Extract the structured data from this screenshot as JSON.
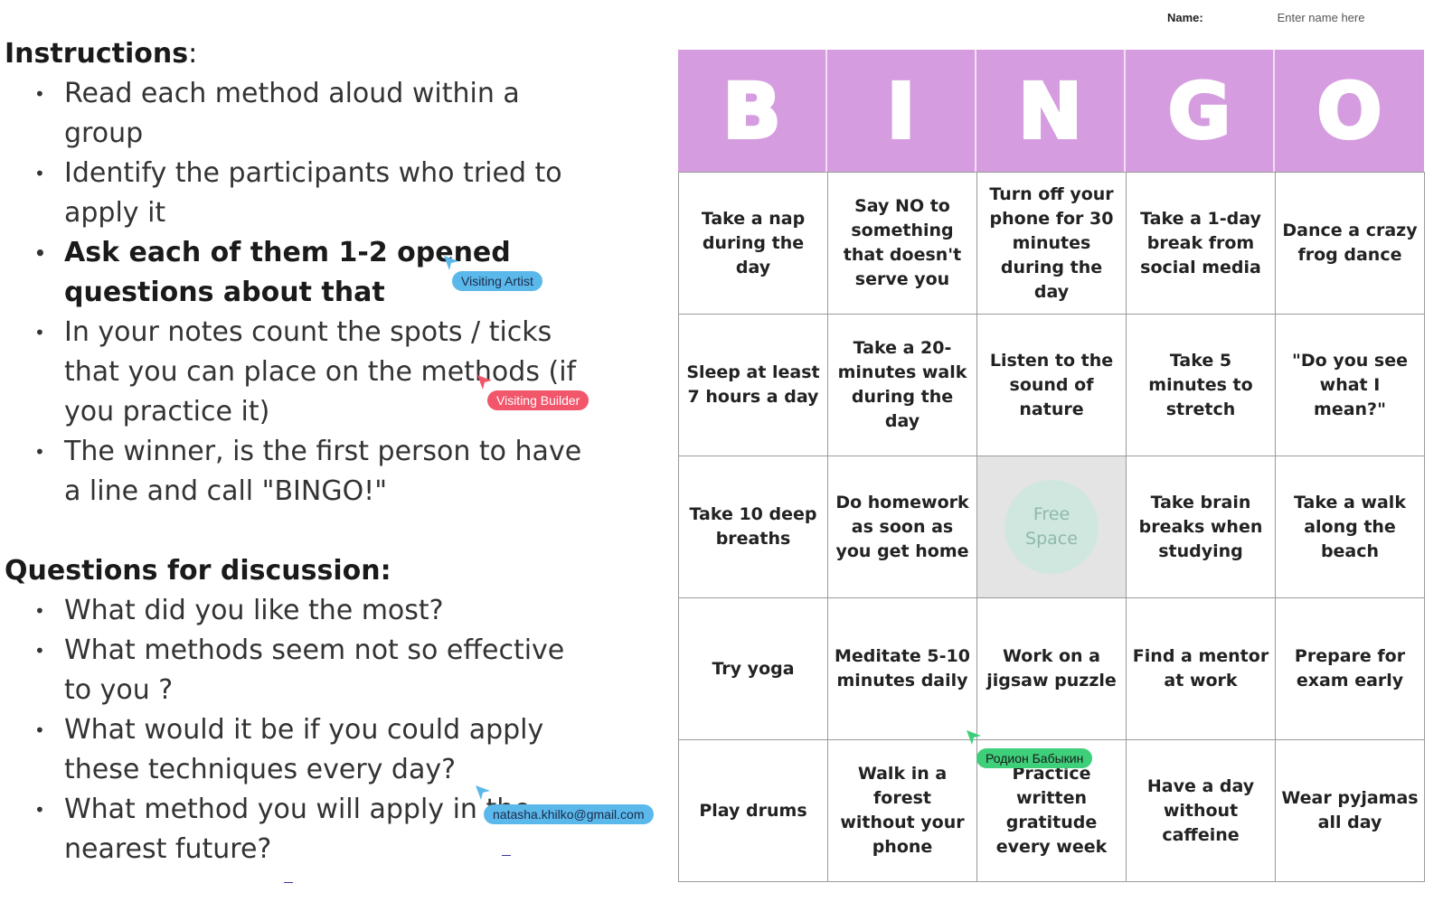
{
  "name_field": {
    "label": "Name:",
    "placeholder": "Enter name here"
  },
  "instructions": {
    "heading": "Instructions",
    "colon": ":",
    "items": [
      "Read each method aloud within a group",
      "Identify the participants who tried to apply it",
      "Ask each of them 1-2 opened questions about that",
      "In your notes count the spots / ticks that you can place on the methods (if you practice it)",
      "The winner, is the first person to have a line and call \"BINGO!\""
    ]
  },
  "questions": {
    "heading": "Questions for discussion:",
    "items": [
      "What did you like the most?",
      "What methods seem not so effective to you ?",
      "What would it be if you could apply these techniques every day?",
      "What method you will apply in the nearest future?"
    ]
  },
  "bingo": {
    "letters": [
      "B",
      "I",
      "N",
      "G",
      "O"
    ],
    "rows": [
      [
        "Take a nap during the day",
        "Say NO to something that doesn't serve you",
        "Turn off your phone for 30 minutes during the day",
        "Take a 1-day break from social media",
        "Dance a crazy frog dance"
      ],
      [
        "Sleep at least 7 hours a day",
        "Take a 20-minutes walk during the day",
        "Listen to the sound of nature",
        "Take 5 minutes to stretch",
        "\"Do you see what I mean?\""
      ],
      [
        "Take 10 deep breaths",
        "Do homework as soon as you get home",
        "Free Space",
        "Take brain breaks when studying",
        "Take a walk along the beach"
      ],
      [
        "Try yoga",
        "Meditate 5-10 minutes daily",
        "Work on a jigsaw puzzle",
        "Find a mentor at work",
        "Prepare for exam early"
      ],
      [
        "Play drums",
        "Walk in a forest without your phone",
        "Practice written gratitude every week",
        "Have a day without caffeine",
        "Wear pyjamas all day"
      ]
    ]
  },
  "cursors": [
    {
      "name": "Visiting Artist",
      "color": "#5bb8ea"
    },
    {
      "name": "Visiting Builder",
      "color": "#f2566b"
    },
    {
      "name": "Родион Бабыкин",
      "color": "#3ecf7a"
    },
    {
      "name": "natasha.khilko@gmail.com",
      "color": "#5bb8ea"
    }
  ],
  "colors": {
    "header_bg": "#d59ddf",
    "free_space_bg": "#e4e4e4",
    "free_circle": "#cfe7df"
  }
}
